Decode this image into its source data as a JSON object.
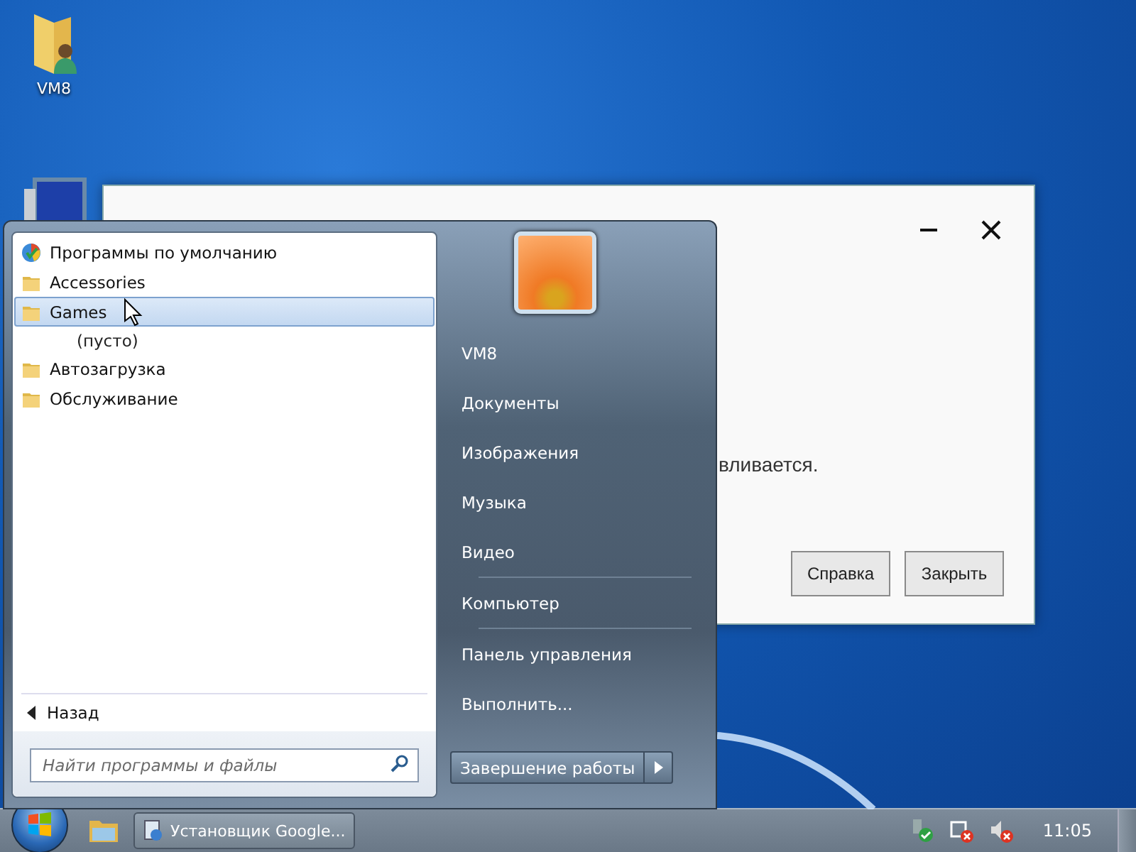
{
  "desktop_icons": [
    {
      "label": "VM8"
    }
  ],
  "dialog": {
    "message": "вливается.",
    "buttons": [
      "Справка",
      "Закрыть"
    ]
  },
  "start_menu": {
    "programs": [
      {
        "label": "Программы по умолчанию",
        "kind": "app",
        "selected": false
      },
      {
        "label": "Accessories",
        "kind": "folder",
        "selected": false
      },
      {
        "label": "Games",
        "kind": "folder",
        "selected": true,
        "children": [
          {
            "label": "(пусто)"
          }
        ]
      },
      {
        "label": "Автозагрузка",
        "kind": "folder",
        "selected": false
      },
      {
        "label": "Обслуживание",
        "kind": "folder",
        "selected": false
      }
    ],
    "back": "Назад",
    "search": {
      "placeholder": "Найти программы и файлы"
    },
    "places": [
      [
        "VM8",
        "Документы",
        "Изображения",
        "Музыка",
        "Видео"
      ],
      [
        "Компьютер"
      ],
      [
        "Панель управления",
        "Выполнить..."
      ]
    ],
    "shutdown": "Завершение работы"
  },
  "taskbar": {
    "tasks": [
      {
        "label": "Установщик Google..."
      }
    ],
    "clock": "11:05"
  }
}
